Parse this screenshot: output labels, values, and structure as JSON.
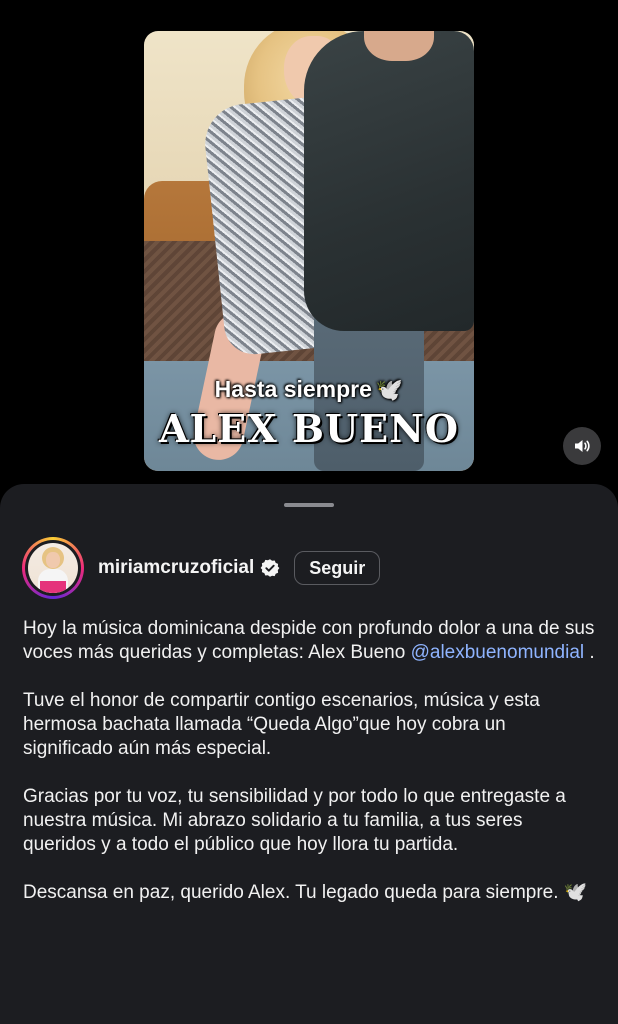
{
  "media": {
    "overlay_line1": "Hasta siempre",
    "overlay_line1_emoji": "🕊️",
    "overlay_line2": "ALEX BUENO",
    "sound_icon": "speaker-icon"
  },
  "post": {
    "username": "miriamcruzoficial",
    "verified_icon": "verified-badge-icon",
    "follow_label": "Seguir",
    "paragraphs": {
      "p1_text": "Hoy la música dominicana despide con profundo dolor a una de sus voces más queridas y completas: Alex Bueno",
      "p1_mention": "@alexbuenomundial",
      "p1_end": ".",
      "p2": "Tuve el honor de compartir contigo escenarios, música y esta hermosa bachata llamada “Queda Algo”que hoy cobra un significado aún más especial.",
      "p3": "Gracias por tu voz, tu sensibilidad y por todo lo que entregaste a nuestra música. Mi abrazo solidario a tu familia, a tus seres queridos y a todo el público que hoy llora tu partida.",
      "p4": "Descansa en paz, querido Alex. Tu legado queda para siempre.",
      "p4_emoji": "🕊️"
    }
  },
  "colors": {
    "background": "#000000",
    "sheet": "#1c1d21",
    "mention": "#8fb4ff",
    "text": "#f1f1f1"
  }
}
